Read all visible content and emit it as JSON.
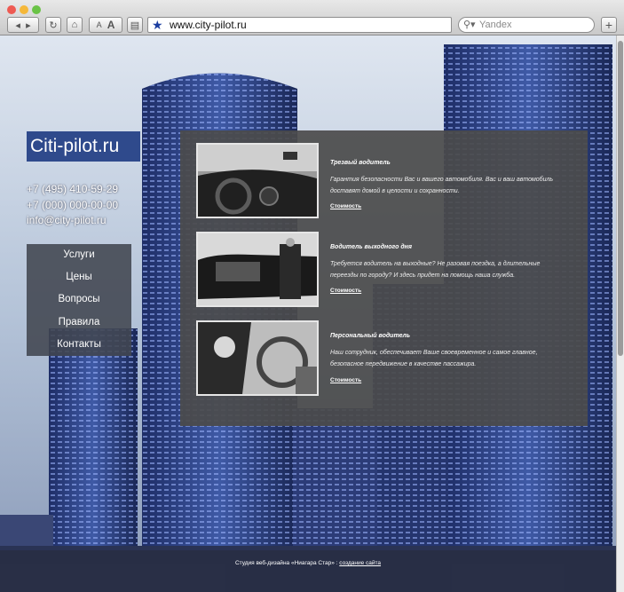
{
  "browser": {
    "url": "www.city-pilot.ru",
    "search_placeholder": "Yandex",
    "font_small_label": "A",
    "font_large_label": "A",
    "new_tab_label": "+"
  },
  "site": {
    "logo": "Citi-pilot.ru",
    "phone1": "+7 (495) 410-59-29",
    "phone2": "+7 (000) 000-00-00",
    "email": "info@city-pilot.ru",
    "nav": [
      "Услуги",
      "Цены",
      "Вопросы",
      "Правила",
      "Контакты"
    ],
    "services": [
      {
        "title": "Трезвый водитель",
        "desc": "Гарантия безопасности Вас и вашего автомобиля. Вас и ваш автомобиль доставят домой в целости и сохранности.",
        "link": "Стоимость"
      },
      {
        "title": "Водитель выходного дня",
        "desc": "Требуется водитель на выходные? Не разовая поездка, а длительные переезды по городу? И здесь придет на помощь наша служба.",
        "link": "Стоимость"
      },
      {
        "title": "Персональный водитель",
        "desc": "Наш сотрудник, обеспечивает Ваше своевременное и самое главное, безопасное передвижение в качестве пассажира.",
        "link": "Стоимость"
      }
    ],
    "footer_prefix": "Студия веб-дизайна «Ниагара Стар» :",
    "footer_link": "создание сайта"
  },
  "colors": {
    "logo_bg": "#2f4a8c",
    "panel_bg": "#4b4b4b",
    "nav_bg": "#414650",
    "traffic_red": "#ee5a52",
    "traffic_yellow": "#f5b83a",
    "traffic_green": "#6ac346"
  }
}
